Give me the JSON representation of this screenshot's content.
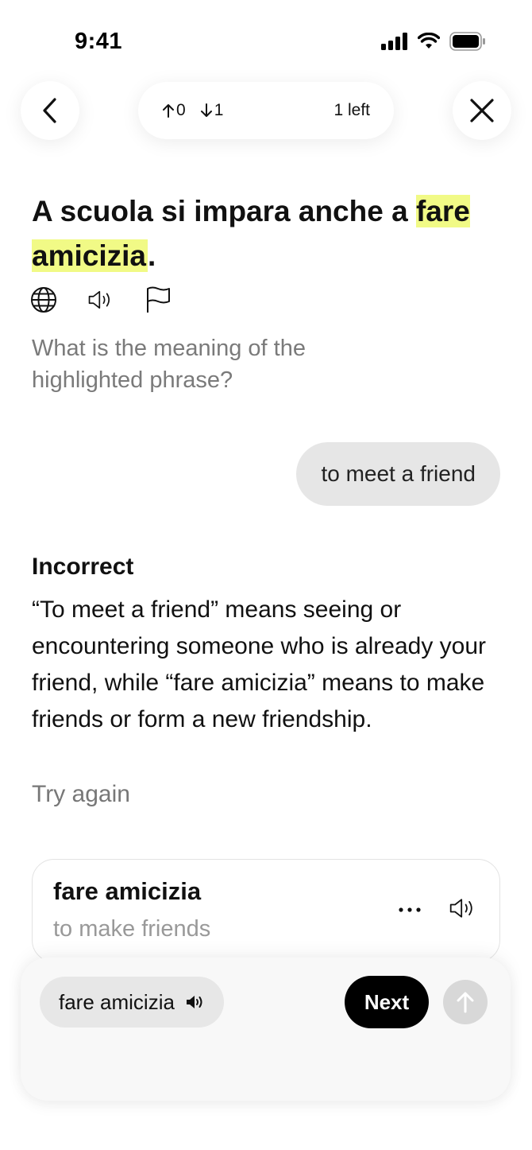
{
  "status_bar": {
    "time": "9:41"
  },
  "progress": {
    "up_count": "0",
    "down_count": "1",
    "remaining": "1 left"
  },
  "sentence": {
    "before": "A scuola si impara anche a ",
    "highlight": "fare amicizia",
    "after": "."
  },
  "question": "What is the meaning of the highlighted phrase?",
  "answer": "to meet a friend",
  "feedback": {
    "result": "Incorrect",
    "explanation": "“To meet a friend” means seeing or encountering someone who is already your friend, while “fare amicizia” means to make friends or form a new friendship.",
    "retry": "Try again"
  },
  "vocab_card": {
    "term": "fare amicizia",
    "translation": "to make friends"
  },
  "bottom_bar": {
    "chip_label": "fare amicizia",
    "next_label": "Next"
  },
  "icons": [
    "back-icon",
    "close-icon",
    "arrow-up-icon",
    "arrow-down-icon",
    "globe-icon",
    "speaker-icon",
    "flag-icon",
    "more-icon",
    "send-arrow-icon"
  ]
}
